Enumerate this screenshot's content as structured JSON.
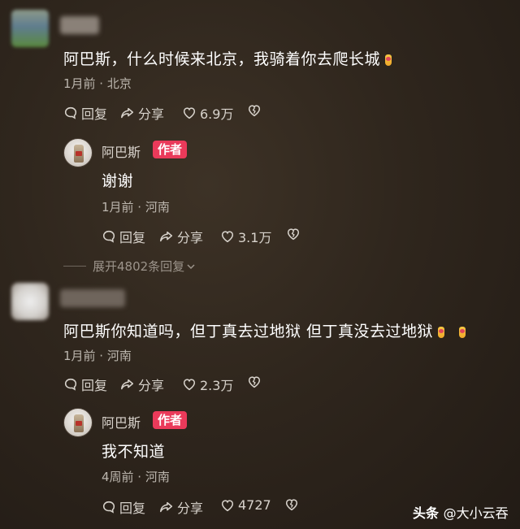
{
  "comments": [
    {
      "text": "阿巴斯，什么时候来北京，我骑着你去爬长城",
      "emoji_count": 1,
      "meta": "1月前 · 北京",
      "reply_label": "回复",
      "share_label": "分享",
      "likes": "6.9万",
      "reply": {
        "name": "阿巴斯",
        "badge": "作者",
        "text": "谢谢",
        "meta": "1月前 · 河南",
        "reply_label": "回复",
        "share_label": "分享",
        "likes": "3.1万"
      },
      "expand_label": "展开4802条回复"
    },
    {
      "text": "阿巴斯你知道吗，但丁真去过地狱 但丁真没去过地狱",
      "emoji_count": 2,
      "meta": "1月前 · 河南",
      "reply_label": "回复",
      "share_label": "分享",
      "likes": "2.3万",
      "reply": {
        "name": "阿巴斯",
        "badge": "作者",
        "text": "我不知道",
        "meta": "4周前 · 河南",
        "reply_label": "回复",
        "share_label": "分享",
        "likes": "4727"
      }
    }
  ],
  "watermark": {
    "brand": "头条",
    "handle": "@大小云吞"
  },
  "icons": {
    "comment": "comment-bubble-icon",
    "share": "share-arrow-icon",
    "like": "heart-icon",
    "dislike": "broken-heart-icon",
    "expand": "chevron-down-icon",
    "emoji": "fingers-crossed-emoji"
  },
  "colors": {
    "badge": "#ea3a5a",
    "background": "#2f261d"
  }
}
